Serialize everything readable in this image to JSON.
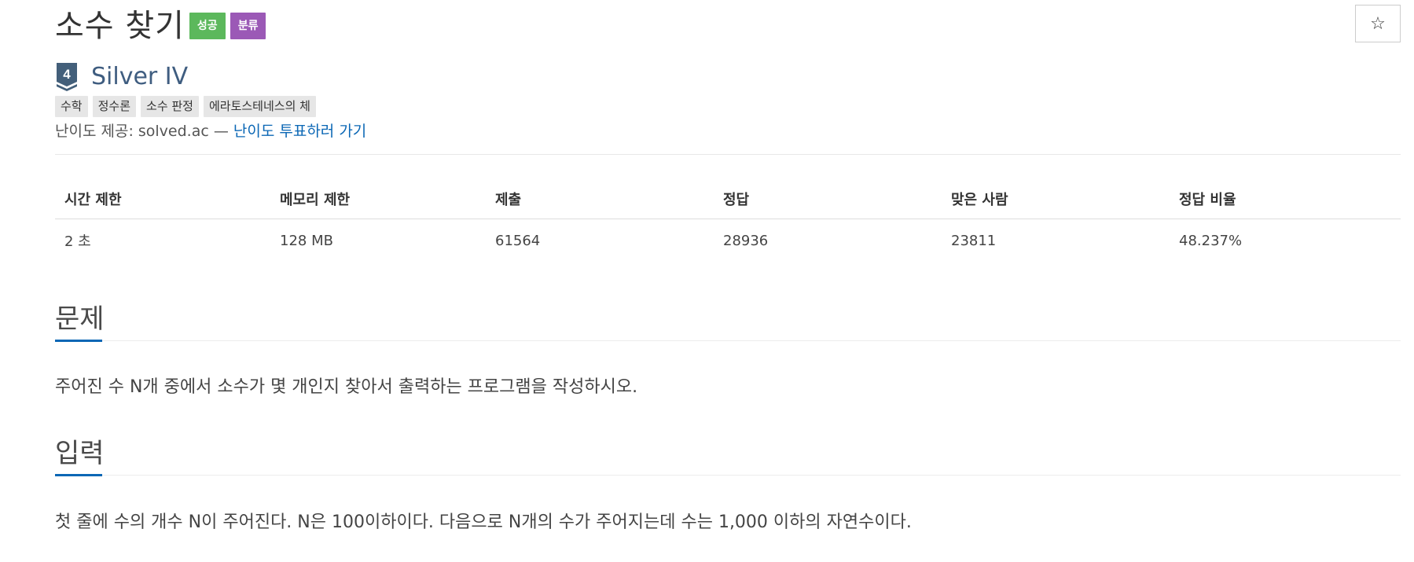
{
  "problem": {
    "title": "소수 찾기",
    "badges": [
      {
        "label": "성공",
        "color": "#5cb85c"
      },
      {
        "label": "분류",
        "color": "#9b59b6"
      }
    ],
    "star_icon": "☆"
  },
  "tier": {
    "level": "4",
    "name": "Silver IV",
    "icon_color": "#435f7a"
  },
  "tags": [
    "수학",
    "정수론",
    "소수 판정",
    "에라토스테네스의 체"
  ],
  "difficulty": {
    "provider_text": "난이도 제공: solved.ac — ",
    "vote_link": "난이도 투표하러 가기"
  },
  "stats": {
    "headers": [
      "시간 제한",
      "메모리 제한",
      "제출",
      "정답",
      "맞은 사람",
      "정답 비율"
    ],
    "values": [
      "2 초",
      "128 MB",
      "61564",
      "28936",
      "23811",
      "48.237%"
    ]
  },
  "sections": [
    {
      "title": "문제",
      "text": "주어진 수 N개 중에서 소수가 몇 개인지 찾아서 출력하는 프로그램을 작성하시오."
    },
    {
      "title": "입력",
      "text": "첫 줄에 수의 개수 N이 주어진다. N은 100이하이다. 다음으로 N개의 수가 주어지는데 수는 1,000 이하의 자연수이다."
    }
  ],
  "colors": {
    "accent": "#0b67b5",
    "tier_text": "#3f5d80"
  }
}
